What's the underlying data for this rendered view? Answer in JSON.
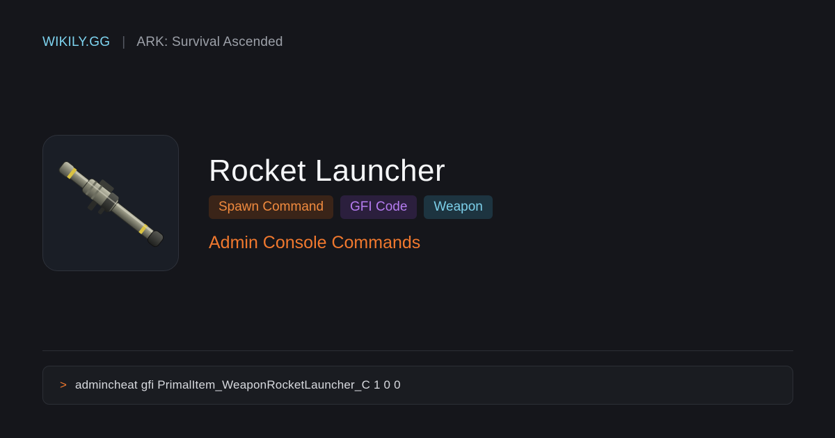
{
  "header": {
    "brand": "WIKILY.GG",
    "separator": "|",
    "game": "ARK: Survival Ascended"
  },
  "item": {
    "title": "Rocket Launcher",
    "icon": "rocket-launcher-image",
    "badges": [
      {
        "label": "Spawn Command",
        "color": "#f08a3e"
      },
      {
        "label": "GFI Code",
        "color": "#b57cf0"
      },
      {
        "label": "Weapon",
        "color": "#7ccfe9"
      }
    ],
    "subtitle": "Admin Console Commands"
  },
  "command": {
    "prompt": ">",
    "text": "admincheat gfi PrimalItem_WeaponRocketLauncher_C  1 0 0"
  },
  "colors": {
    "background": "#15161b",
    "accent_orange": "#f0782e",
    "brand_cyan": "#7dd3ef"
  }
}
